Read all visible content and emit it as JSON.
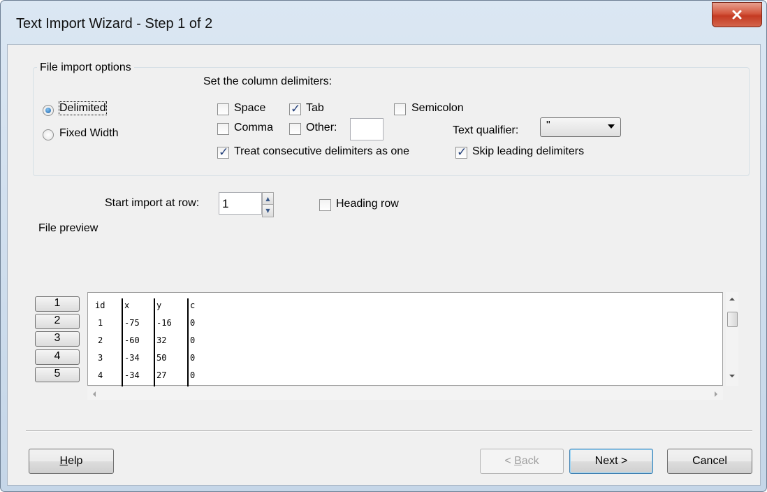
{
  "window": {
    "title": "Text Import Wizard - Step 1 of 2"
  },
  "file_import_options": {
    "legend": "File import options",
    "radios": [
      {
        "label": "Delimited",
        "checked": true
      },
      {
        "label": "Fixed Width",
        "checked": false
      }
    ],
    "delimiters_heading": "Set the column delimiters:",
    "checkboxes": {
      "space": {
        "label": "Space",
        "checked": false
      },
      "tab": {
        "label": "Tab",
        "checked": true
      },
      "semicolon": {
        "label": "Semicolon",
        "checked": false
      },
      "comma": {
        "label": "Comma",
        "checked": false
      },
      "other": {
        "label": "Other:",
        "checked": false,
        "value": ""
      },
      "consecutive": {
        "label": "Treat consecutive delimiters as one",
        "checked": true
      },
      "skip_leading": {
        "label": "Skip leading delimiters",
        "checked": true
      }
    },
    "text_qualifier": {
      "label": "Text qualifier:",
      "value": "\""
    }
  },
  "start_row": {
    "label": "Start import at row:",
    "value": "1"
  },
  "heading_row": {
    "label": "Heading row",
    "checked": false
  },
  "file_preview": {
    "label": "File preview",
    "row_numbers": [
      "1",
      "2",
      "3",
      "4",
      "5"
    ],
    "rows": [
      [
        "id",
        "x",
        "y",
        "c"
      ],
      [
        "1",
        "-75",
        "-16",
        "0"
      ],
      [
        "2",
        "-60",
        "32",
        "0"
      ],
      [
        "3",
        "-34",
        "50",
        "0"
      ],
      [
        "4",
        "-34",
        "27",
        "0"
      ]
    ]
  },
  "buttons": {
    "help": {
      "prefix": "",
      "mnemonic": "H",
      "suffix": "elp"
    },
    "back": {
      "prefix": "< ",
      "mnemonic": "B",
      "suffix": "ack"
    },
    "next": "Next >",
    "cancel": "Cancel"
  },
  "icons": {
    "close": "close-icon",
    "spin_up": "spin-up-icon",
    "spin_down": "spin-down-icon",
    "scroll_up": "scroll-up-icon",
    "scroll_down": "scroll-down-icon",
    "scroll_left": "scroll-left-icon",
    "scroll_right": "scroll-right-icon",
    "dropdown": "chevron-down-icon"
  },
  "colors": {
    "title_bar": "#dbe7f3",
    "close_button": "#c43a22",
    "dialog_bg": "#f0f0f0"
  }
}
